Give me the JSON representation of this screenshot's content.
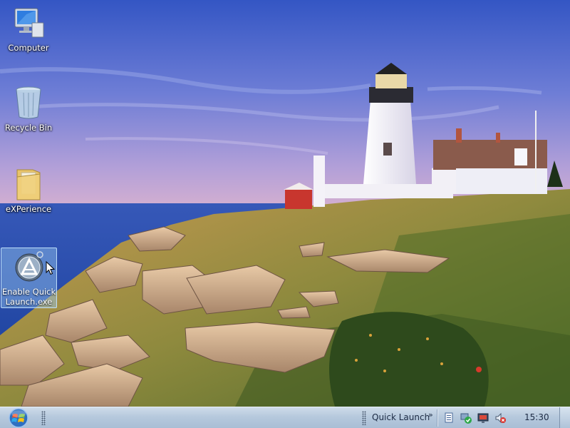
{
  "desktop": {
    "icons": [
      {
        "label": "Computer",
        "icon": "computer-monitor-icon"
      },
      {
        "label": "Recycle Bin",
        "icon": "recycle-bin-icon"
      },
      {
        "label": "eXPerience",
        "icon": "folder-icon"
      },
      {
        "label": "Enable Quick\nLaunch.exe",
        "icon": "quick-launch-app-icon",
        "selected": true
      }
    ],
    "wallpaper": "lighthouse-on-rocky-coast-at-sunset"
  },
  "taskbar": {
    "start_button": "windows-orb-icon",
    "quick_launch_label": "Quick Launch",
    "quick_launch_chevron": "»",
    "tray_icons": [
      "network-doc-icon",
      "security-check-icon",
      "monitor-icon",
      "volume-muted-icon"
    ],
    "clock": "15:30"
  },
  "colors": {
    "taskbar": "#b6c9dd",
    "taskbar_text": "#1d2b44",
    "selection": "#96c8f0",
    "sky_top": "#3a5cc8",
    "sea": "#1f4aa8"
  }
}
